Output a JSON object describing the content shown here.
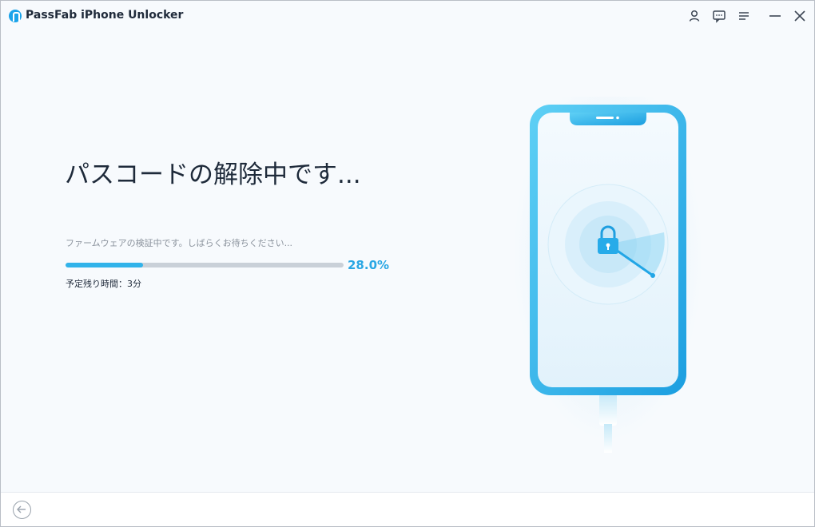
{
  "app": {
    "title": "PassFab iPhone Unlocker",
    "icons": {
      "logo": "passfab-logo-icon",
      "account": "user-icon",
      "feedback": "feedback-icon",
      "menu": "menu-icon",
      "minimize": "minimize-icon",
      "close": "close-icon"
    }
  },
  "main": {
    "headline": "パスコードの解除中です...",
    "status_message": "ファームウェアの検証中です。しばらくお待ちください...",
    "progress": {
      "value": 28.0,
      "label": "28.0%"
    },
    "time_remaining": "予定残り時間：3分"
  },
  "illustration": {
    "icon": "phone-lock-icon",
    "accent_color": "#2fb4ec"
  },
  "footer": {
    "back_icon": "back-arrow-icon"
  },
  "colors": {
    "accent": "#31b3ea",
    "progress_track": "#c9d0d8",
    "background": "#f7fafd"
  }
}
